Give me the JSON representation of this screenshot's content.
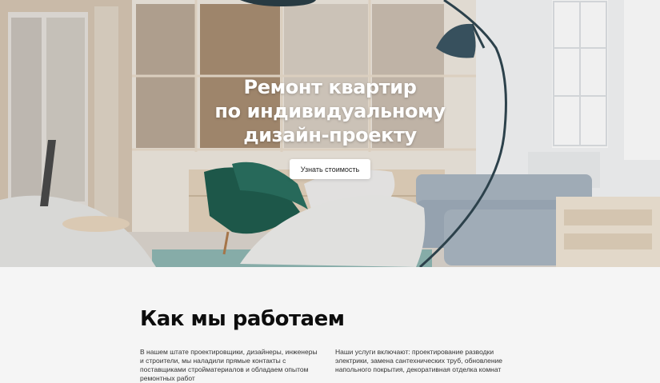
{
  "hero": {
    "title_lines": [
      "Ремонт квартир",
      "по индивидуальному",
      "дизайн-проекту"
    ],
    "cta_label": "Узнать стоимость"
  },
  "section": {
    "title": "Как мы работаем",
    "col1": "В нашем штате проектировщики, дизайнеры, инженеры и строители, мы наладили прямые контакты с поставщиками стройматериалов и обладаем опытом ремонтных работ",
    "col2": "Наши услуги включают: проектирование разводки электрики, замена сантехнических труб, обновление напольного покрытия, декоративная отделка комнат"
  },
  "colors": {
    "page_bg": "#f5f5f5",
    "cta_bg": "#ffffff",
    "title_color": "#0d0d0d",
    "hero_text": "#ffffff"
  }
}
